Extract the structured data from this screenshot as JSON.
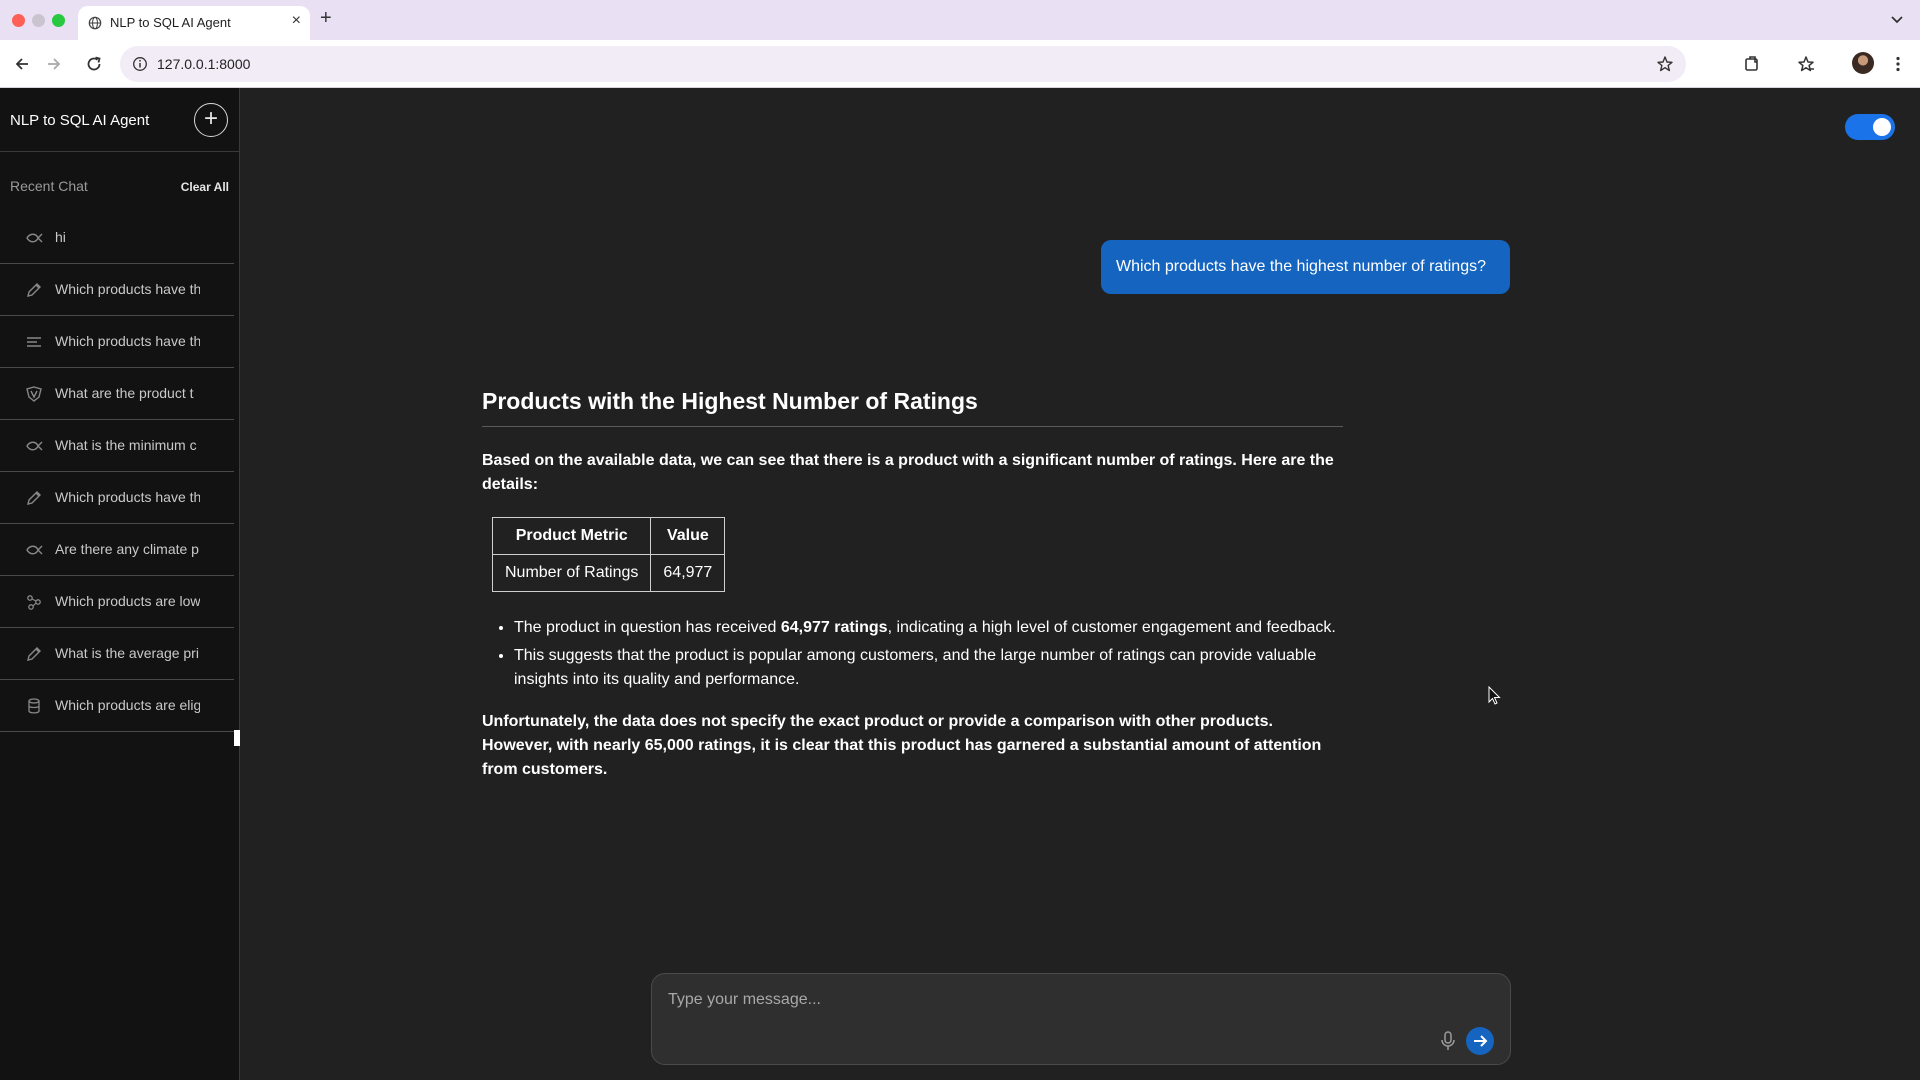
{
  "browser": {
    "tab_title": "NLP to SQL AI Agent",
    "url": "127.0.0.1:8000"
  },
  "sidebar": {
    "title": "NLP to SQL AI Agent",
    "recent_label": "Recent Chat",
    "clear_label": "Clear All",
    "items": [
      {
        "label": "hi",
        "icon": "chat-fish-icon"
      },
      {
        "label": "Which products have th",
        "icon": "pencil-icon"
      },
      {
        "label": "Which products have th",
        "icon": "list-icon"
      },
      {
        "label": "What are the product t",
        "icon": "shield-icon"
      },
      {
        "label": "What is the minimum c",
        "icon": "chat-fish-icon"
      },
      {
        "label": "Which products have th",
        "icon": "pencil-icon"
      },
      {
        "label": "Are there any climate p",
        "icon": "chat-fish-icon"
      },
      {
        "label": "Which products are low",
        "icon": "nodes-icon"
      },
      {
        "label": "What is the average pri",
        "icon": "pencil-icon"
      },
      {
        "label": "Which products are elig",
        "icon": "database-icon"
      }
    ]
  },
  "chat": {
    "user_message": "Which products have the highest number of ratings?",
    "answer": {
      "heading": "Products with the Highest Number of Ratings",
      "intro": "Based on the available data, we can see that there is a product with a significant number of ratings. Here are the details:",
      "table": {
        "headers": [
          "Product Metric",
          "Value"
        ],
        "rows": [
          [
            "Number of Ratings",
            "64,977"
          ]
        ]
      },
      "bullets": [
        {
          "pre": "The product in question has received ",
          "bold": "64,977 ratings",
          "post": ", indicating a high level of customer engagement and feedback."
        },
        {
          "pre": "This suggests that the product is popular among customers, and the large number of ratings can provide valuable insights into its quality and performance.",
          "bold": "",
          "post": ""
        }
      ],
      "conclusion": "Unfortunately, the data does not specify the exact product or provide a comparison with other products. However, with nearly 65,000 ratings, it is clear that this product has garnered a substantial amount of attention from customers."
    }
  },
  "composer": {
    "placeholder": "Type your message..."
  },
  "colors": {
    "accent": "#1565c0",
    "toggle": "#1a73e8",
    "background": "#212121",
    "sidebar": "#121212"
  }
}
